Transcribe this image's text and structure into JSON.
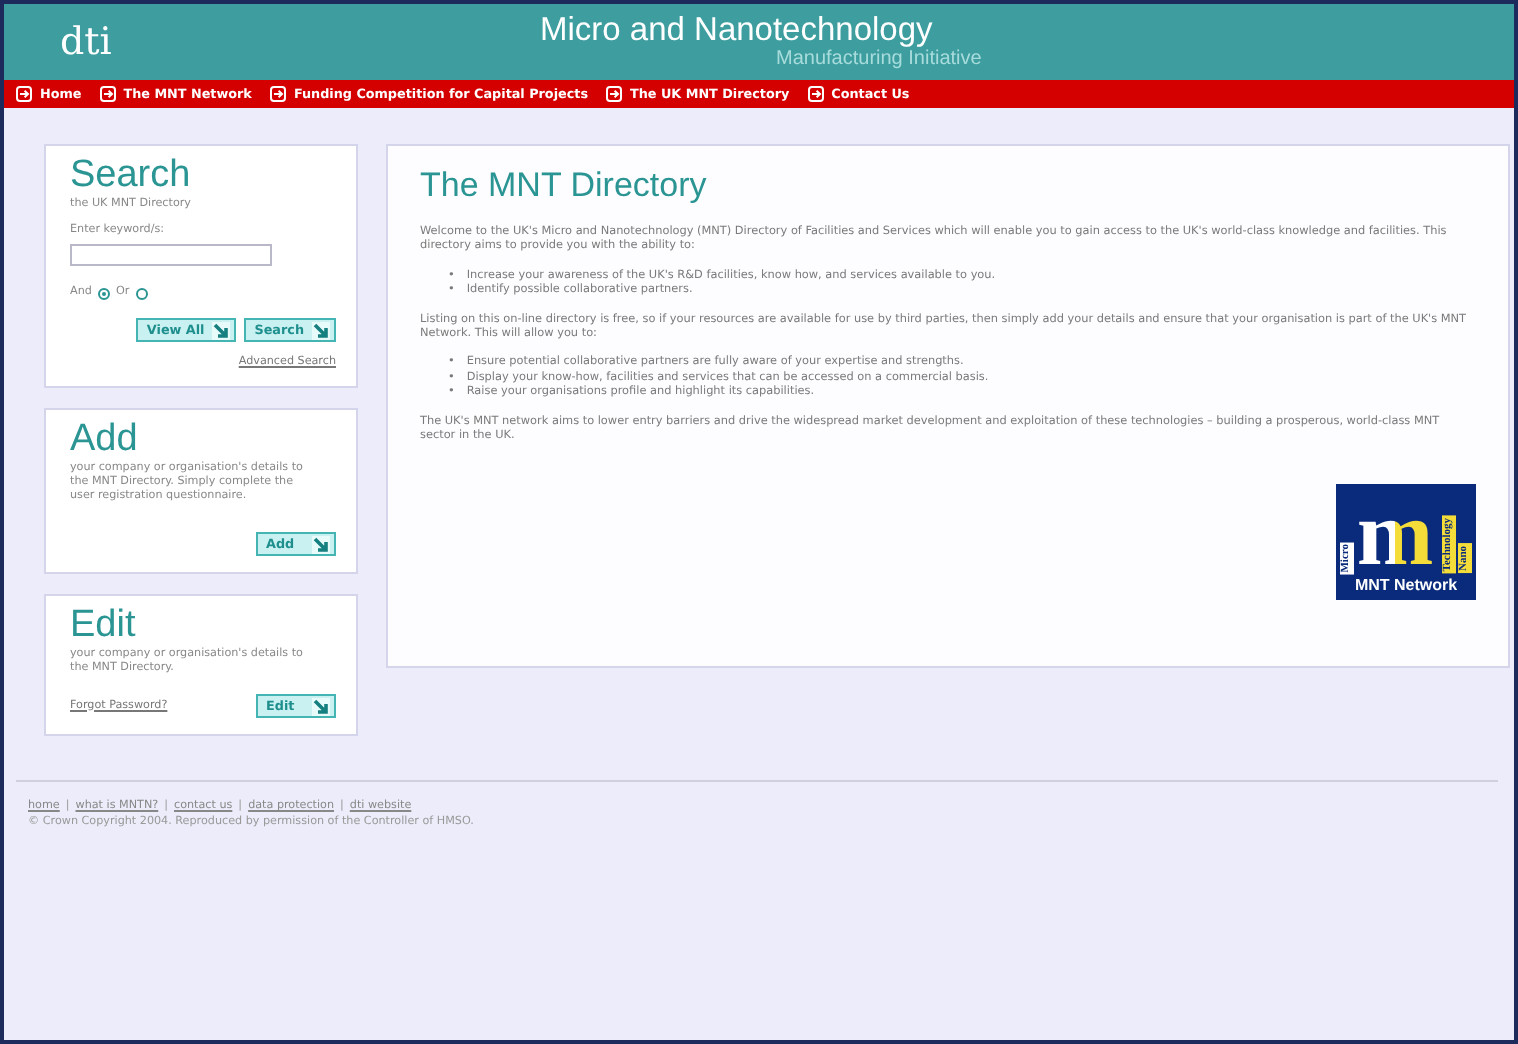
{
  "header": {
    "logo": "dti",
    "title": "Micro and Nanotechnology",
    "subtitle": "Manufacturing Initiative"
  },
  "nav": [
    {
      "label": "Home"
    },
    {
      "label": "The MNT Network"
    },
    {
      "label": "Funding Competition for Capital Projects"
    },
    {
      "label": "The UK MNT Directory"
    },
    {
      "label": "Contact Us"
    }
  ],
  "sidebar": [
    {
      "kind": "search",
      "title": "Search",
      "subtitle": "the UK MNT Directory",
      "field_label": "Enter keyword/s:",
      "options": [
        {
          "label": "And",
          "selected": true
        },
        {
          "label": "Or",
          "selected": false
        }
      ],
      "buttons": [
        "View All",
        "Search"
      ],
      "link": "Advanced Search"
    },
    {
      "kind": "add",
      "title": "Add",
      "text": "your company or organisation's details to the MNT Directory. Simply complete the user registration questionnaire.",
      "buttons": [
        "Add"
      ]
    },
    {
      "kind": "edit",
      "title": "Edit",
      "text": "your company or organisation's details to the MNT Directory.",
      "link": "Forgot Password?",
      "buttons": [
        "Edit"
      ]
    }
  ],
  "main": {
    "title": "The MNT Directory",
    "blocks": [
      {
        "kind": "paragraph",
        "text": "Welcome to the UK's Micro and Nanotechnology (MNT) Directory of Facilities and Services which will enable you to gain access to the UK's world-class knowledge and facilities. This directory aims to provide you with the ability to:"
      },
      {
        "kind": "list",
        "marker": "•",
        "items": [
          "Increase your awareness of the UK's R&D facilities, know how, and services available to you.",
          "Identify possible collaborative partners."
        ]
      },
      {
        "kind": "paragraph",
        "text": "Listing on this on-line directory is free, so if your resources are available for use by third parties, then simply add your details and ensure that your organisation is part of the UK's MNT Network. This will allow you to:"
      },
      {
        "kind": "list",
        "marker": "•",
        "items": [
          "Ensure potential collaborative partners are fully aware of your expertise and strengths.",
          "Display your know-how, facilities and services that can be accessed on a commercial basis.",
          "Raise your organisations profile and highlight its capabilities."
        ]
      },
      {
        "kind": "paragraph",
        "text": "The UK's MNT network aims to lower entry barriers and drive the widespread market development and exploitation of these technologies – building a prosperous, world-class MNT sector in the UK."
      }
    ],
    "logo": {
      "letter": "m",
      "words": [
        "Micro",
        "Technology",
        "Nano"
      ],
      "caption": "MNT Network"
    }
  },
  "footer": {
    "links": [
      "home",
      "what is MNTN?",
      "contact us",
      "data protection",
      "dti website"
    ],
    "separators": [
      "|",
      "|",
      "|",
      "|"
    ],
    "copyright": "© Crown Copyright 2004. Reproduced by permission of the Controller of HMSO."
  }
}
